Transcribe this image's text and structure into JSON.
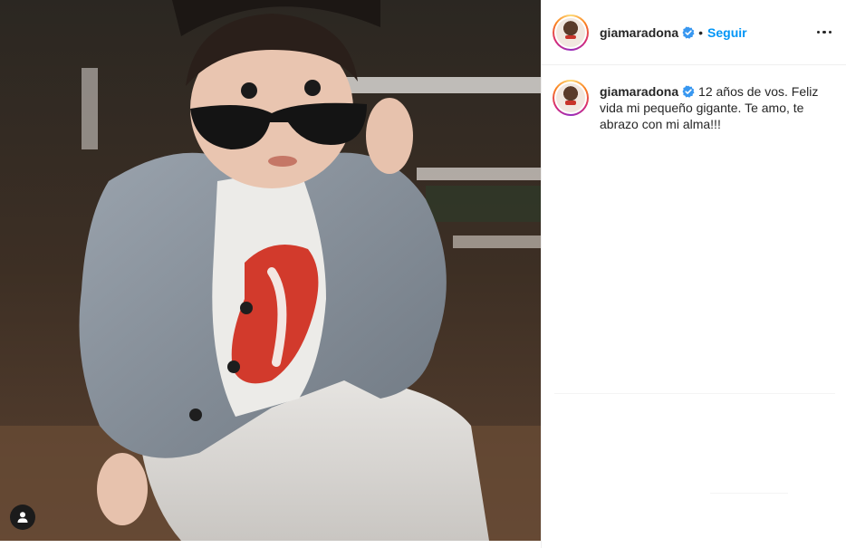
{
  "header": {
    "username": "giamaradona",
    "follow_label": "Seguir",
    "more_icon": "more-dots-icon"
  },
  "caption": {
    "username": "giamaradona",
    "text_line1": "12 años de vos. Feliz",
    "text_line2": "vida mi pequeño gigante. Te amo, te",
    "text_line3": "abrazo con mi alma!!!"
  },
  "photo": {
    "user_tag_icon": "user-tag-icon"
  },
  "colors": {
    "accent": "#0095f6",
    "verified": "#3897f0",
    "text": "#262626"
  }
}
